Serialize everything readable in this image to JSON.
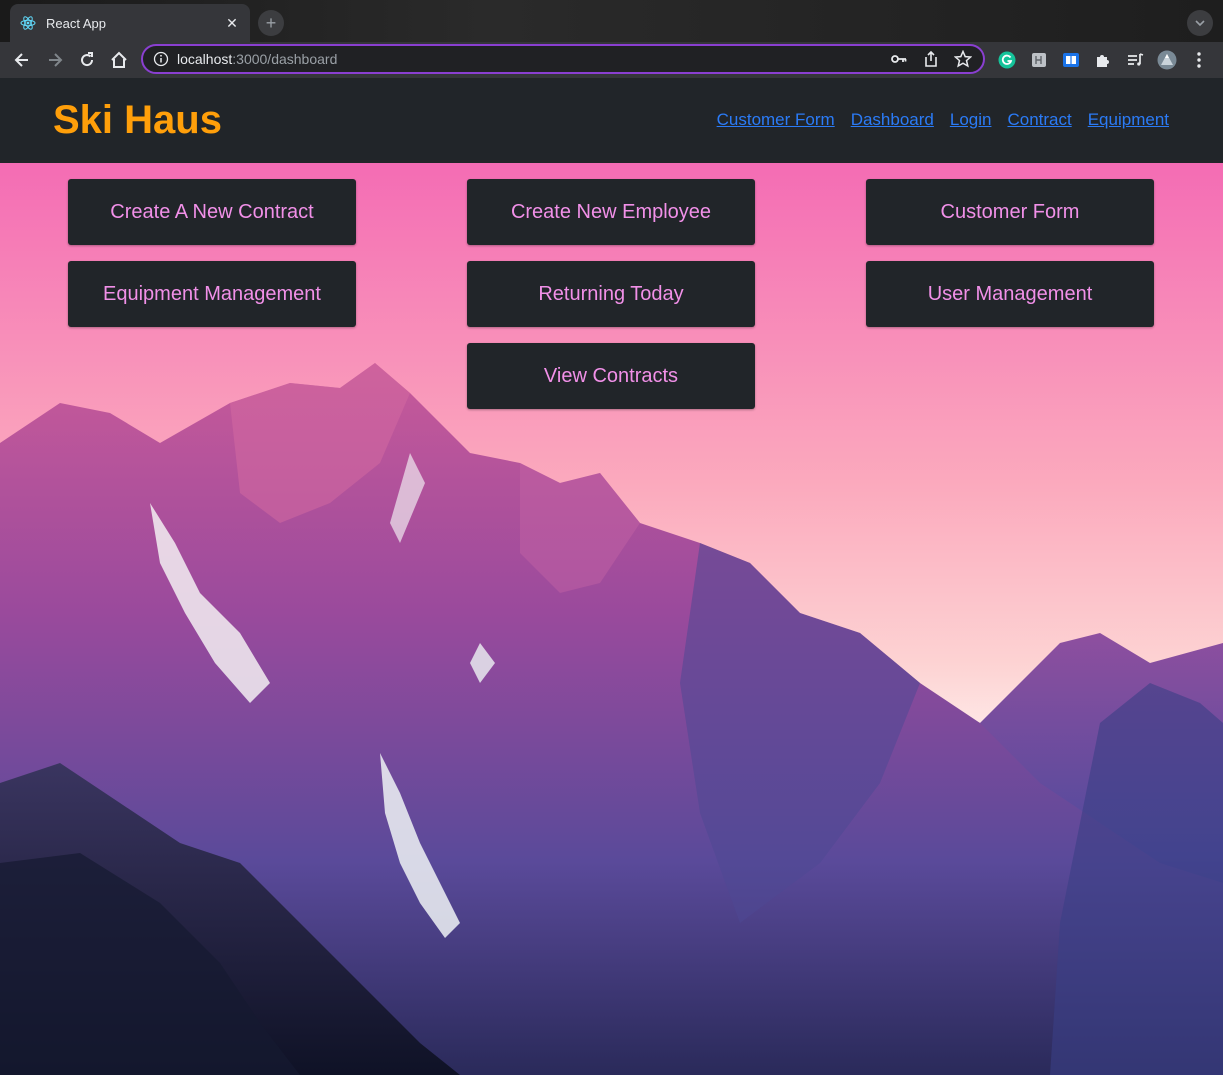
{
  "browser": {
    "tab_title": "React App",
    "url_host": "localhost",
    "url_path": ":3000/dashboard"
  },
  "navbar": {
    "brand": "Ski Haus",
    "links": [
      "Customer Form",
      "Dashboard",
      "Login",
      "Contract",
      "Equipment"
    ]
  },
  "dashboard": {
    "buttons": [
      "Create A New Contract",
      "Create New Employee",
      "Customer Form",
      "Equipment Management",
      "Returning Today",
      "User Management",
      "View Contracts"
    ]
  },
  "colors": {
    "brand": "#ff9f0a",
    "link": "#2b7bf6",
    "button_bg": "#212529",
    "button_text": "#f190e8",
    "omnibox_focus": "#8a3fd1"
  }
}
